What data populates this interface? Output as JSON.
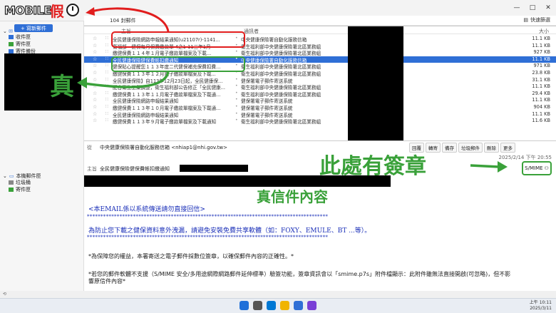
{
  "logo": {
    "text": "MOBILE",
    "mark": "假"
  },
  "window": {
    "controls": [
      "—",
      "□",
      "✕"
    ]
  },
  "list_header": {
    "count": "104 封郵件",
    "quick_filter": "快速篩選"
  },
  "sidebar": {
    "new_mail": "+ 寫新郵件",
    "folders": [
      {
        "label": "收件匣",
        "icon": "inbox-icon"
      },
      {
        "label": "寄件匣",
        "icon": "outbox-icon"
      },
      {
        "label": "寄件備份",
        "icon": "sent-icon"
      }
    ],
    "local_account": "本機郵件匣",
    "local_folders": [
      {
        "label": "垃圾桶",
        "icon": "trash-icon"
      },
      {
        "label": "寄件匣",
        "icon": "outbox-icon"
      }
    ]
  },
  "columns": {
    "subject": "主旨",
    "correspondent": "通訊者",
    "size": "大小"
  },
  "messages": [
    {
      "subject": "全民健康保險網路申報結果通知(u21107r)-1141...",
      "corr": "中央健康保險署自動化服務信箱",
      "size": "11.1 KB",
      "star": "☆",
      "selected": false
    },
    {
      "subject": "衛福部－健保每月保費繳款單 4之1-11三年1月",
      "corr": "衛生福利部中央健康保險署北區業務組",
      "size": "11.1 KB",
      "star": "☆",
      "selected": false
    },
    {
      "subject": "繳健保費１１４年１月電子繳款單檔案及下載...",
      "corr": "衛生福利部中央健康保險署北區業務組",
      "size": "927 KB",
      "star": "☆",
      "selected": false
    },
    {
      "subject": "全民健康保險健保費帳扣繳通知",
      "corr": "中央健康保險署自動化服務信箱",
      "size": "11.1 KB",
      "star": "☆",
      "selected": true
    },
    {
      "subject": "健保貼心提醒您１１３年度二代健保補充保費扣費...",
      "corr": "衛生福利部中央健康保險署北區業務組",
      "size": "971 KB",
      "star": "☆",
      "selected": false
    },
    {
      "subject": "繳健保費１１３年１２月電子繳款單檔案及下載...",
      "corr": "衛生福利部中央健康保險署北區業務組",
      "size": "23.8 KB",
      "star": "☆",
      "selected": false
    },
    {
      "subject": "全民健康保險】自113年12月23日起，全民健康保...",
      "corr": "健保署電子郵件寄送系統",
      "size": "31.1 KB",
      "star": "☆",
      "selected": false
    },
    {
      "subject": "配合衛生工業調整，衛生福利部公告修正「全民健康...",
      "corr": "衛生福利部中央健康保險署北區業務組",
      "size": "11.1 KB",
      "star": "☆",
      "selected": false
    },
    {
      "subject": "繳健保費１１３年１１月電子繳款單檔案及下載通...",
      "corr": "衛生福利部中央健康保險署北區業務組",
      "size": "29.4 KB",
      "star": "☆",
      "selected": false
    },
    {
      "subject": "全民健康保險網路申報結果通知",
      "corr": "健保署電子郵件寄送系統",
      "size": "11.1 KB",
      "star": "☆",
      "selected": false
    },
    {
      "subject": "繳健保費１１３年１０月電子繳款單檔案及下載通...",
      "corr": "健保署電子郵件寄送系統",
      "size": "904 KB",
      "star": "☆",
      "selected": false
    },
    {
      "subject": "全民健康保險網路申報結果通知",
      "corr": "健保署電子郵件寄送系統",
      "size": "11.1 KB",
      "star": "☆",
      "selected": false
    },
    {
      "subject": "繳健保費１１３年９月電子繳款單檔案及下載通知",
      "corr": "衛生福利部中央健康保險署北區業務組",
      "size": "11.6 KB",
      "star": "☆",
      "selected": false
    }
  ],
  "message_view": {
    "from_label": "從",
    "from": "中央健康保險署自動化服務信箱 <nhiap1@nhi.gov.tw>",
    "subject_label": "主旨",
    "subject": "全民健康保險健保費帳扣繳通知",
    "date": "2025/2/14 下午 20:55",
    "actions": [
      "回覆",
      "轉寄",
      "備存",
      "垃圾郵件",
      "刪除",
      "更多"
    ],
    "smime": "S/MIME"
  },
  "body": {
    "line1": "<本EMAIL係以系統傳送請勿直接回信>",
    "stars": "*****************************************************************************************",
    "line2": "為防止您下載之健保資料意外洩漏，請避免安裝免費共享軟體（如：FOXY、EMULE、BT ...等）。",
    "p1": "*為保障您的權益，本署寄送之電子郵件採數位簽章，以確保郵件內容的正確性。*",
    "p2": "*若您的郵件軟體不支援（S/MIME 安全/多用途網際網路郵件延伸標準）驗簽功能，簽章資訊會以「smime.p7s」附件檔顯示：此附件雖無法直接開啟(可忽略)，但不影響原信件內容*"
  },
  "annotations": {
    "fake": "假",
    "real": "真",
    "signature_here": "此處有簽章",
    "real_content": "真信件內容"
  },
  "colors": {
    "accent": "#2f6fd6",
    "green": "#3aa13a",
    "red": "#e11d1d",
    "body_blue": "#1a2fb8"
  },
  "taskbar": {
    "time": "上午 10:11",
    "date": "2025/3/11"
  }
}
